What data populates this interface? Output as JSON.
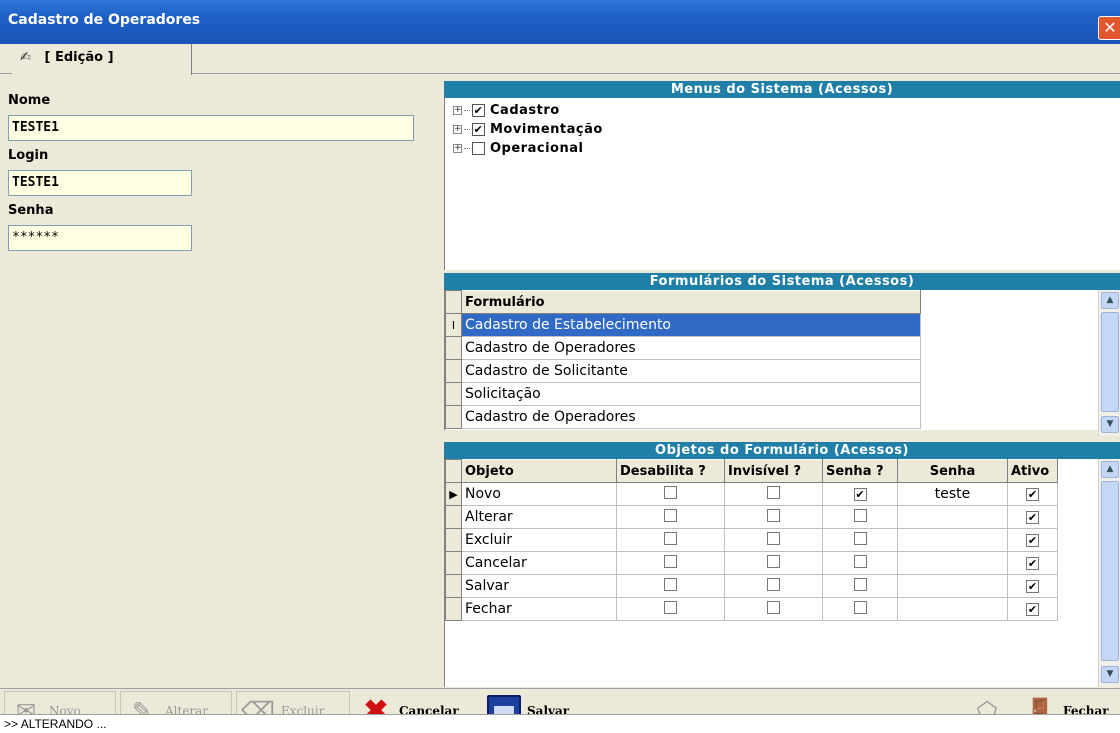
{
  "window": {
    "title": "Cadastro de Operadores"
  },
  "tab": {
    "label": "[ Edição ]"
  },
  "form": {
    "nome_label": "Nome",
    "nome_value": "TESTE1",
    "login_label": "Login",
    "login_value": "TESTE1",
    "senha_label": "Senha",
    "senha_value": "******"
  },
  "menus": {
    "header": "Menus do Sistema (Acessos)",
    "items": [
      {
        "label": "Cadastro",
        "checked": true
      },
      {
        "label": "Movimentação",
        "checked": true
      },
      {
        "label": "Operacional",
        "checked": false
      }
    ]
  },
  "forms_grid": {
    "header": "Formulários do Sistema (Acessos)",
    "column": "Formulário",
    "rows": [
      "Cadastro de Estabelecimento",
      "Cadastro de Operadores",
      "Cadastro de Solicitante",
      "Solicitação",
      "Cadastro de Operadores"
    ]
  },
  "objects_grid": {
    "header": "Objetos do Formulário (Acessos)",
    "columns": [
      "Objeto",
      "Desabilita ?",
      "Invisível ?",
      "Senha ?",
      "Senha",
      "Ativo"
    ],
    "rows": [
      {
        "objeto": "Novo",
        "desabilita": false,
        "invisivel": false,
        "senha_flag": true,
        "senha": "teste",
        "ativo": true
      },
      {
        "objeto": "Alterar",
        "desabilita": false,
        "invisivel": false,
        "senha_flag": false,
        "senha": "",
        "ativo": true
      },
      {
        "objeto": "Excluir",
        "desabilita": false,
        "invisivel": false,
        "senha_flag": false,
        "senha": "",
        "ativo": true
      },
      {
        "objeto": "Cancelar",
        "desabilita": false,
        "invisivel": false,
        "senha_flag": false,
        "senha": "",
        "ativo": true
      },
      {
        "objeto": "Salvar",
        "desabilita": false,
        "invisivel": false,
        "senha_flag": false,
        "senha": "",
        "ativo": true
      },
      {
        "objeto": "Fechar",
        "desabilita": false,
        "invisivel": false,
        "senha_flag": false,
        "senha": "",
        "ativo": true
      }
    ]
  },
  "toolbar": {
    "novo": "Novo",
    "alterar": "Alterar",
    "excluir": "Excluir",
    "cancelar": "Cancelar",
    "salvar": "Salvar",
    "fechar": "Fechar"
  },
  "status": {
    "text": ">> ALTERANDO ..."
  }
}
